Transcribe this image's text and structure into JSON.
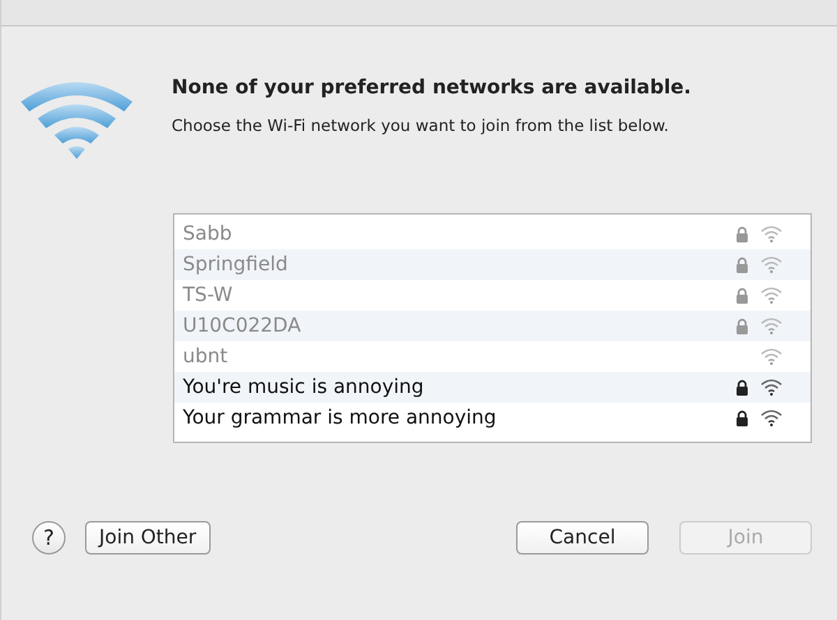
{
  "heading": "None of your preferred networks are available.",
  "subheading": "Choose the Wi-Fi network you want to join from the list below.",
  "networks": [
    {
      "name": "Sabb",
      "disabled": true,
      "locked": true
    },
    {
      "name": "Springfield",
      "disabled": true,
      "locked": true
    },
    {
      "name": "TS-W",
      "disabled": true,
      "locked": true
    },
    {
      "name": "U10C022DA",
      "disabled": true,
      "locked": true
    },
    {
      "name": "ubnt",
      "disabled": true,
      "locked": false
    },
    {
      "name": "You're music is annoying",
      "disabled": false,
      "locked": true
    },
    {
      "name": "Your grammar is more annoying",
      "disabled": false,
      "locked": true
    }
  ],
  "help": "?",
  "buttons": [
    {
      "label": "Join Other",
      "disabled": false,
      "kind": "left"
    },
    {
      "label": "Cancel",
      "disabled": false,
      "kind": "right"
    },
    {
      "label": "Join",
      "disabled": true,
      "kind": "right"
    }
  ]
}
